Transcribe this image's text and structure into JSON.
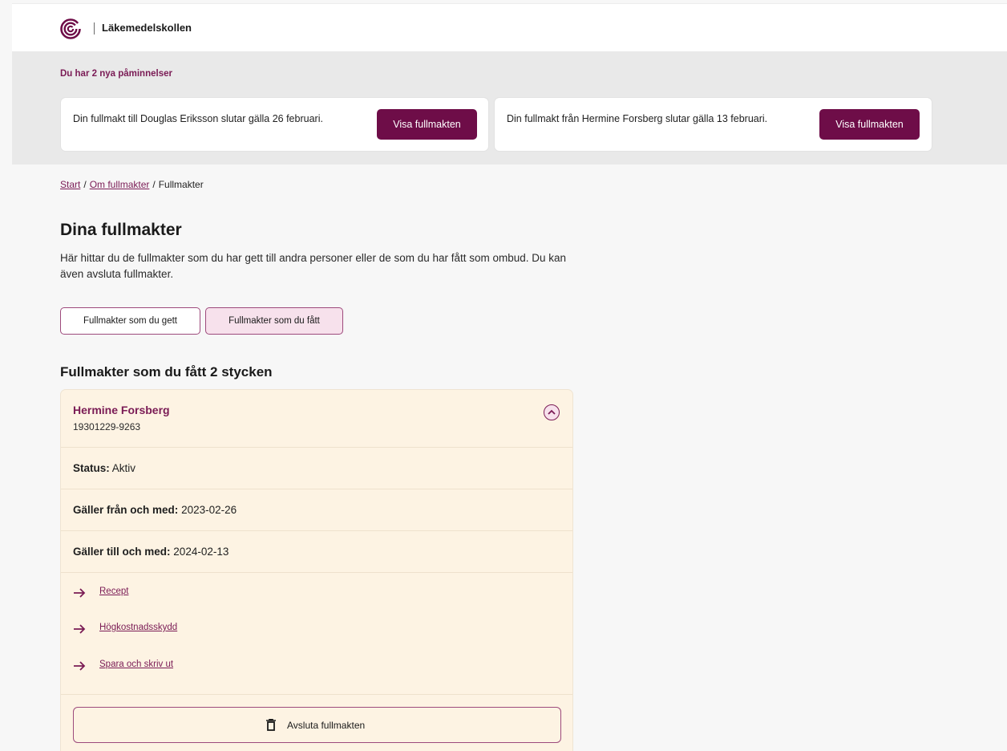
{
  "header": {
    "brand": "Läkemedelskollen",
    "logo_icon": "brand-swirl-icon",
    "accent": "#6e0d48"
  },
  "reminders": {
    "heading": "Du har 2 nya påminnelser",
    "items": [
      {
        "text": "Din fullmakt till Douglas Eriksson slutar gälla 26 februari.",
        "button": "Visa fullmakten"
      },
      {
        "text": "Din fullmakt från Hermine Forsberg slutar gälla 13 februari.",
        "button": "Visa fullmakten"
      }
    ]
  },
  "breadcrumb": {
    "items": [
      "Start",
      "Om fullmakter",
      "Fullmakter"
    ],
    "separator": "/"
  },
  "page": {
    "title": "Dina fullmakter",
    "intro": "Här hittar du de fullmakter som du har gett till andra personer eller de som du har fått som ombud. Du kan även avsluta fullmakter."
  },
  "tabs": [
    {
      "label": "Fullmakter som du gett",
      "selected": false
    },
    {
      "label": "Fullmakter som du fått",
      "selected": true
    }
  ],
  "section": {
    "title": "Fullmakter som du fått",
    "count": "2 stycken"
  },
  "card": {
    "name": "Hermine Forsberg",
    "id": "19301229-9263",
    "expanded": true,
    "status_label": "Status:",
    "status_value": "Aktiv",
    "from_label": "Gäller från och med:",
    "from_value": "2023-02-26",
    "to_label": "Gäller till och med:",
    "to_value": "2024-02-13",
    "links": [
      "Recept",
      "Högkostnadsskydd",
      "Spara och skriv ut"
    ],
    "end_button": "Avsluta fullmakten",
    "background": "#fdf3e3"
  }
}
